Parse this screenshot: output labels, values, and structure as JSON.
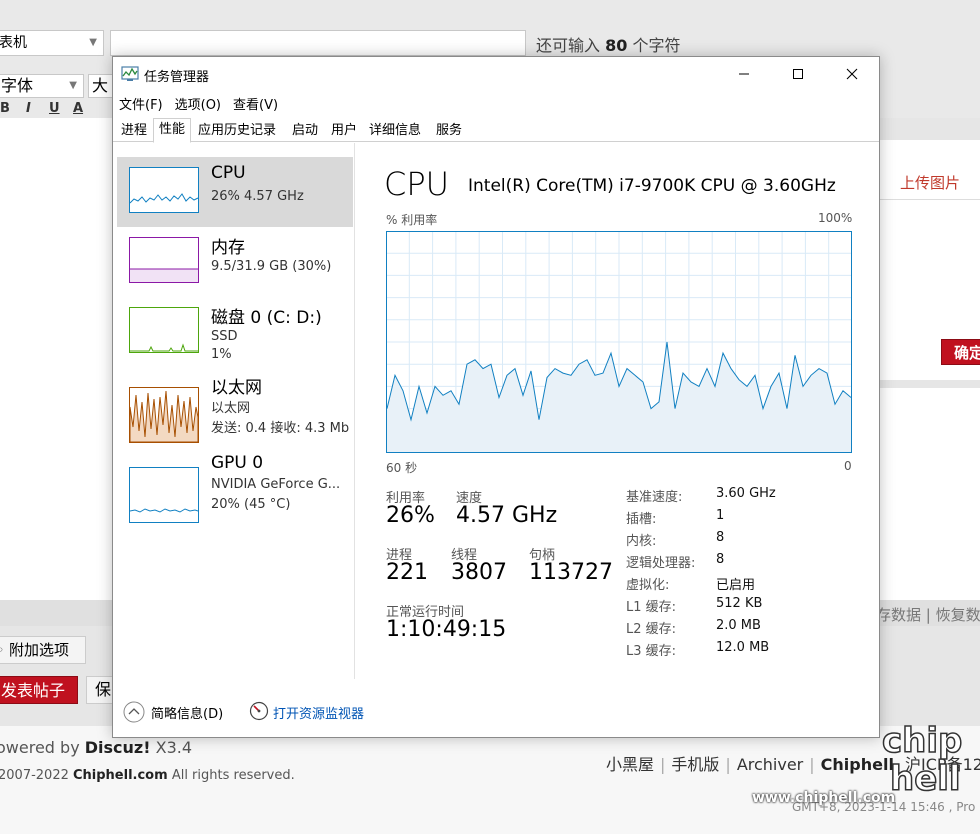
{
  "bg": {
    "select_value": "表机",
    "remaining": {
      "prefix": "还可输入",
      "count": "80",
      "suffix": "个字符"
    },
    "font_label": "字体",
    "size_label": "大小",
    "format_buttons": [
      "B",
      "I",
      "U",
      "A"
    ],
    "upload_label": "上传图片",
    "confirm_label": "确定",
    "restore_label": "存数据 | 恢复数",
    "attach_label": "附加选项",
    "post_label": "发表帖子",
    "save_label": "保",
    "powered_prefix": "owered by",
    "powered_brand": "Discuz!",
    "powered_version": "X3.4",
    "copyright_prefix": "2007-2022",
    "copyright_brand": "Chiphell.com",
    "copyright_suffix": "All rights reserved.",
    "footer_links": [
      "小黑屋",
      "手机版",
      "Archiver"
    ],
    "footer_brand": "Chiphell",
    "footer_icp": "沪ICP备120",
    "gmt": "GMT+8, 2023-1-14 15:46 , Pro",
    "watermark_text": "chip hell",
    "watermark_url": "www.chiphell.com"
  },
  "window": {
    "title": "任务管理器",
    "menus": [
      "文件(F)",
      "选项(O)",
      "查看(V)"
    ],
    "tabs": [
      "进程",
      "性能",
      "应用历史记录",
      "启动",
      "用户",
      "详细信息",
      "服务"
    ],
    "active_tab": "性能"
  },
  "sidebar": {
    "items": [
      {
        "name": "CPU",
        "sub1": "26%  4.57 GHz",
        "sub2": "",
        "color": "#1180c2"
      },
      {
        "name": "内存",
        "sub1": "9.5/31.9 GB (30%)",
        "sub2": "",
        "color": "#8b18a6"
      },
      {
        "name": "磁盘 0 (C: D:)",
        "sub1": "SSD",
        "sub2": "1%",
        "color": "#4da60c"
      },
      {
        "name": "以太网",
        "sub1": "以太网",
        "sub2": "发送: 0.4  接收: 4.3 Mb",
        "color": "#a74f01"
      },
      {
        "name": "GPU 0",
        "sub1": "NVIDIA GeForce G...",
        "sub2": "20% (45 °C)",
        "color": "#1180c2"
      }
    ]
  },
  "main": {
    "heading": "CPU",
    "model": "Intel(R) Core(TM) i7-9700K CPU @ 3.60GHz",
    "graph_label": "% 利用率",
    "graph_max": "100%",
    "graph_span": "60 秒",
    "graph_min": "0",
    "stats": {
      "util_label": "利用率",
      "util_value": "26%",
      "speed_label": "速度",
      "speed_value": "4.57 GHz",
      "proc_label": "进程",
      "proc_value": "221",
      "thread_label": "线程",
      "thread_value": "3807",
      "handle_label": "句柄",
      "handle_value": "113727",
      "uptime_label": "正常运行时间",
      "uptime_value": "1:10:49:15"
    },
    "specs": [
      {
        "k": "基准速度:",
        "v": "3.60 GHz"
      },
      {
        "k": "插槽:",
        "v": "1"
      },
      {
        "k": "内核:",
        "v": "8"
      },
      {
        "k": "逻辑处理器:",
        "v": "8"
      },
      {
        "k": "虚拟化:",
        "v": "已启用"
      },
      {
        "k": "L1 缓存:",
        "v": "512 KB"
      },
      {
        "k": "L2 缓存:",
        "v": "2.0 MB"
      },
      {
        "k": "L3 缓存:",
        "v": "12.0 MB"
      }
    ],
    "cpu_history": [
      20,
      35,
      28,
      15,
      30,
      18,
      30,
      26,
      28,
      22,
      40,
      42,
      38,
      40,
      25,
      35,
      38,
      26,
      37,
      15,
      34,
      38,
      36,
      35,
      40,
      42,
      35,
      36,
      45,
      30,
      38,
      35,
      32,
      20,
      23,
      50,
      20,
      36,
      32,
      30,
      38,
      30,
      45,
      38,
      33,
      30,
      35,
      20,
      30,
      36,
      20,
      44,
      30,
      35,
      38,
      36,
      22,
      28,
      25
    ]
  },
  "bottom": {
    "brief_label": "简略信息(D)",
    "monitor_label": "打开资源监视器"
  }
}
